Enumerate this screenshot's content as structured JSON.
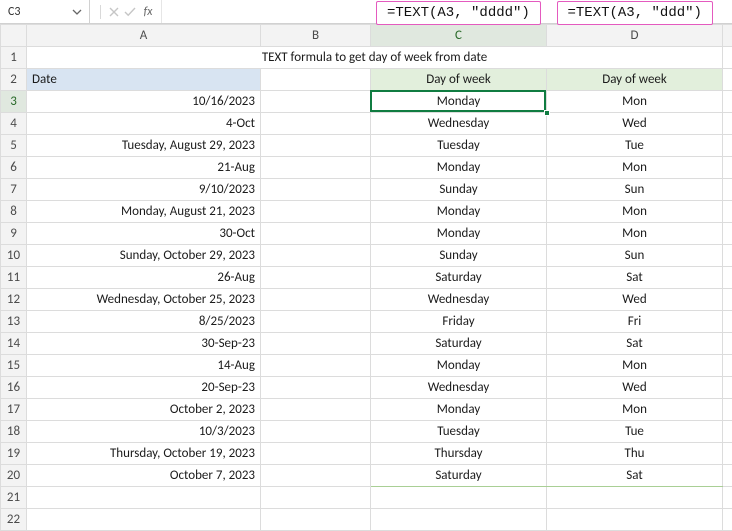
{
  "namebox": "C3",
  "formula_input": "",
  "callouts": {
    "c": "=TEXT(A3, \"dddd\")",
    "d": "=TEXT(A3, \"ddd\")"
  },
  "columns": [
    "A",
    "B",
    "C",
    "D"
  ],
  "title": "TEXT formula to get day of week from date",
  "headers": {
    "a": "Date",
    "c": "Day of week",
    "d": "Day of week"
  },
  "rows": [
    {
      "n": 3,
      "date": "10/16/2023",
      "c": "Monday",
      "d": "Mon"
    },
    {
      "n": 4,
      "date": "4-Oct",
      "c": "Wednesday",
      "d": "Wed"
    },
    {
      "n": 5,
      "date": "Tuesday, August 29, 2023",
      "c": "Tuesday",
      "d": "Tue"
    },
    {
      "n": 6,
      "date": "21-Aug",
      "c": "Monday",
      "d": "Mon"
    },
    {
      "n": 7,
      "date": "9/10/2023",
      "c": "Sunday",
      "d": "Sun"
    },
    {
      "n": 8,
      "date": "Monday, August 21, 2023",
      "c": "Monday",
      "d": "Mon"
    },
    {
      "n": 9,
      "date": "30-Oct",
      "c": "Monday",
      "d": "Mon"
    },
    {
      "n": 10,
      "date": "Sunday, October 29, 2023",
      "c": "Sunday",
      "d": "Sun"
    },
    {
      "n": 11,
      "date": "26-Aug",
      "c": "Saturday",
      "d": "Sat"
    },
    {
      "n": 12,
      "date": "Wednesday, October 25, 2023",
      "c": "Wednesday",
      "d": "Wed"
    },
    {
      "n": 13,
      "date": "8/25/2023",
      "c": "Friday",
      "d": "Fri"
    },
    {
      "n": 14,
      "date": "30-Sep-23",
      "c": "Saturday",
      "d": "Sat"
    },
    {
      "n": 15,
      "date": "14-Aug",
      "c": "Monday",
      "d": "Mon"
    },
    {
      "n": 16,
      "date": "20-Sep-23",
      "c": "Wednesday",
      "d": "Wed"
    },
    {
      "n": 17,
      "date": "October 2, 2023",
      "c": "Monday",
      "d": "Mon"
    },
    {
      "n": 18,
      "date": "10/3/2023",
      "c": "Tuesday",
      "d": "Tue"
    },
    {
      "n": 19,
      "date": "Thursday, October 19, 2023",
      "c": "Thursday",
      "d": "Thu"
    },
    {
      "n": 20,
      "date": "October 7, 2023",
      "c": "Saturday",
      "d": "Sat"
    }
  ],
  "empty_rows": [
    21,
    22
  ]
}
